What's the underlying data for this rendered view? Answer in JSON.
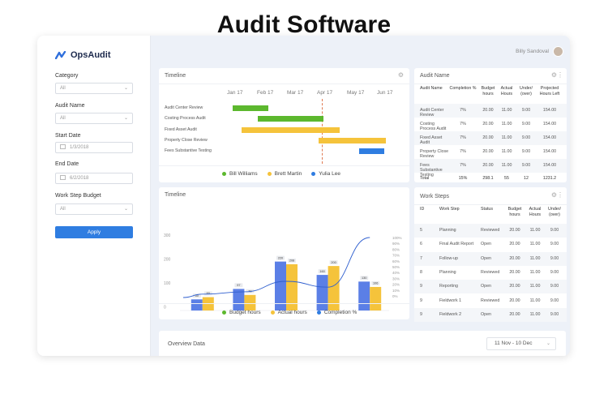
{
  "page_title": "Audit Software",
  "app": {
    "logo_text": "OpsAudit",
    "user_name": "Billy Sandoval"
  },
  "filters": {
    "category_label": "Category",
    "category_value": "All",
    "audit_name_label": "Audit Name",
    "audit_name_value": "All",
    "start_date_label": "Start Date",
    "start_date_value": "1/3/2018",
    "end_date_label": "End Date",
    "end_date_value": "6/2/2018",
    "work_step_budget_label": "Work Step Budget",
    "work_step_budget_value": "All",
    "apply_label": "Apply"
  },
  "timeline": {
    "title": "Timeline",
    "months": [
      "Jan 17",
      "Feb 17",
      "Mar 17",
      "Apr 17",
      "May 17",
      "Jun 17"
    ],
    "tasks": [
      {
        "label": "Audit Center Review",
        "start": 0.05,
        "end": 0.25,
        "color": "#5cb82e"
      },
      {
        "label": "Costing Process Audit",
        "start": 0.19,
        "end": 0.56,
        "color": "#5cb82e"
      },
      {
        "label": "Fixed Asset Audit",
        "start": 0.1,
        "end": 0.65,
        "color": "#f5c33b"
      },
      {
        "label": "Property Close Review",
        "start": 0.53,
        "end": 0.91,
        "color": "#f5c33b"
      },
      {
        "label": "Fees Substantive Testing",
        "start": 0.76,
        "end": 0.9,
        "color": "#2f7de1"
      }
    ],
    "legend": [
      {
        "label": "Bill Williams",
        "color": "#5cb82e"
      },
      {
        "label": "Brett Martin",
        "color": "#f5c33b"
      },
      {
        "label": "Yulia Lee",
        "color": "#2f7de1"
      }
    ]
  },
  "hours_chart": {
    "title": "Timeline",
    "legend": [
      {
        "label": "Budget hours",
        "color": "#5cb82e"
      },
      {
        "label": "Actual hours",
        "color": "#f5c33b"
      },
      {
        "label": "Completion %",
        "color": "#2f7de1"
      }
    ]
  },
  "chart_data": {
    "type": "bar",
    "categories": [
      "Audit Center Review",
      "Costing Process Audit",
      "Fixed Asset Audit",
      "Property Close Review",
      "Fees Substantive Testing"
    ],
    "series": [
      {
        "name": "Budget hours",
        "values": [
          50,
          97,
          220,
          160,
          130
        ],
        "color": "#5b7fe6"
      },
      {
        "name": "Actual hours",
        "values": [
          60,
          70,
          208,
          200,
          106
        ],
        "color": "#f5c33b"
      },
      {
        "name": "Completion %",
        "values": [
          3,
          7,
          25,
          15,
          100
        ],
        "color": "#2f5fcf",
        "type": "line"
      }
    ],
    "y_ticks": [
      "300",
      "200",
      "100",
      "0"
    ],
    "y2_ticks": [
      "100%",
      "90%",
      "80%",
      "70%",
      "60%",
      "50%",
      "40%",
      "30%",
      "20%",
      "10%",
      "0%"
    ],
    "ylim": [
      0,
      300
    ],
    "y2lim": [
      0,
      100
    ]
  },
  "audit_table": {
    "title": "Audit Name",
    "headers": [
      "Audit Name",
      "Completion %",
      "Budget hours",
      "Actual Hours",
      "Under/ (over)",
      "Projected Hours Left"
    ],
    "rows": [
      [
        "Audit Center Review",
        "7%",
        "20.00",
        "11.00",
        "9.00",
        "154.00"
      ],
      [
        "Costing Process Audit",
        "7%",
        "20.00",
        "11.00",
        "9.00",
        "154.00"
      ],
      [
        "Fixed Asset Audit",
        "7%",
        "20.00",
        "11.00",
        "9.00",
        "154.00"
      ],
      [
        "Property Close Review",
        "7%",
        "20.00",
        "11.00",
        "9.00",
        "154.00"
      ],
      [
        "Fees Substantive Testing",
        "7%",
        "20.00",
        "11.00",
        "9.00",
        "154.00"
      ]
    ],
    "total": [
      "Total",
      "15%",
      "298.1",
      "55",
      "12",
      "1231.2"
    ]
  },
  "work_steps": {
    "title": "Work Steps",
    "headers": [
      "ID",
      "Work Step",
      "Status",
      "Budget hours",
      "Actual Hours",
      "Under/ (over)"
    ],
    "rows": [
      [
        "5",
        "Planning",
        "Reviewed",
        "20.00",
        "11.00",
        "9.00"
      ],
      [
        "6",
        "Final Audit Report",
        "Open",
        "20.00",
        "11.00",
        "9.00"
      ],
      [
        "7",
        "Follow-up",
        "Open",
        "20.00",
        "11.00",
        "9.00"
      ],
      [
        "8",
        "Planning",
        "Reviewed",
        "20.00",
        "11.00",
        "9.00"
      ],
      [
        "9",
        "Reporting",
        "Open",
        "20.00",
        "11.00",
        "9.00"
      ],
      [
        "9",
        "Fieldwork 1",
        "Reviewed",
        "20.00",
        "11.00",
        "9.00"
      ],
      [
        "9",
        "Fieldwork 2",
        "Open",
        "20.00",
        "11.00",
        "9.00"
      ]
    ]
  },
  "overview": {
    "title": "Overview Data",
    "date_range": "11 Nov - 10 Dec"
  }
}
